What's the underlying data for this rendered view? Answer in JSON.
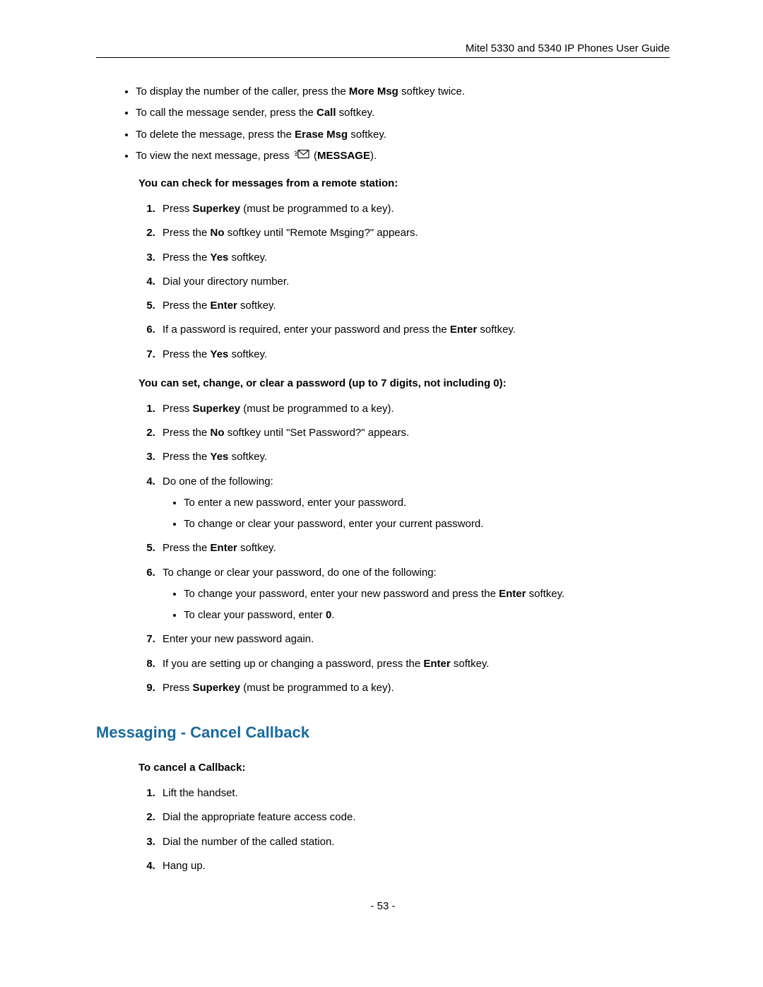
{
  "header": {
    "title": "Mitel 5330 and 5340 IP Phones User Guide"
  },
  "section1": {
    "bullets": [
      {
        "prefix": "To display the number of the caller, press the ",
        "bold1": "More Msg",
        "mid": "  softkey twice."
      },
      {
        "prefix": "To call the message sender, press the ",
        "bold1": "Call",
        "mid": " softkey."
      },
      {
        "prefix": "To delete the message, press the ",
        "bold1": "Erase Msg",
        "mid": " softkey."
      },
      {
        "prefix": "To view the next message, press ",
        "icon": true,
        "after_icon_prefix": " (",
        "bold1": "MESSAGE",
        "mid": ")."
      }
    ],
    "subhead1": "You can check for messages from a remote station:",
    "steps1": [
      {
        "pre": "Press ",
        "b1": "Superkey",
        "post": " (must be programmed to a key)."
      },
      {
        "pre": "Press the ",
        "b1": "No",
        "post": " softkey until \"Remote Msging?\" appears."
      },
      {
        "pre": "Press the ",
        "b1": "Yes",
        "post": " softkey."
      },
      {
        "pre": "Dial your directory number."
      },
      {
        "pre": "Press the ",
        "b1": "Enter",
        "post": " softkey."
      },
      {
        "pre": "If a password is required, enter your password and press the ",
        "b1": "Enter",
        "post": " softkey."
      },
      {
        "pre": "Press the ",
        "b1": "Yes",
        "post": " softkey."
      }
    ],
    "subhead2": "You can set, change, or clear a password (up to 7 digits, not including 0):",
    "steps2": [
      {
        "pre": "Press ",
        "b1": "Superkey",
        "post": " (must be programmed to a key)."
      },
      {
        "pre": "Press the ",
        "b1": "No",
        "post": " softkey until \"Set Password?\" appears."
      },
      {
        "pre": "Press the ",
        "b1": "Yes",
        "post": " softkey."
      },
      {
        "pre": "Do one of the following:",
        "sub": [
          {
            "text": "To enter a new password, enter your password."
          },
          {
            "text": "To change or clear your password, enter your current password."
          }
        ]
      },
      {
        "pre": "Press the ",
        "b1": "Enter",
        "post": " softkey."
      },
      {
        "pre": "To change or clear your password, do one of the following:",
        "sub": [
          {
            "pre": "To change your password, enter your new password and press the ",
            "b1": "Enter",
            "post": " softkey."
          },
          {
            "pre": "To clear your password, enter ",
            "b1": "0",
            "post": "."
          }
        ]
      },
      {
        "pre": "Enter your new password again."
      },
      {
        "pre": "If you are setting up or changing a password, press the ",
        "b1": "Enter",
        "post": " softkey."
      },
      {
        "pre": "Press ",
        "b1": "Superkey",
        "post": " (must be programmed to a key)."
      }
    ]
  },
  "section2": {
    "title": "Messaging - Cancel Callback",
    "subhead": "To cancel a Callback:",
    "steps": [
      {
        "pre": "Lift the handset."
      },
      {
        "pre": "Dial the appropriate feature access code."
      },
      {
        "pre": "Dial the number of the called station."
      },
      {
        "pre": "Hang up."
      }
    ]
  },
  "footer": {
    "page": "- 53 -"
  }
}
